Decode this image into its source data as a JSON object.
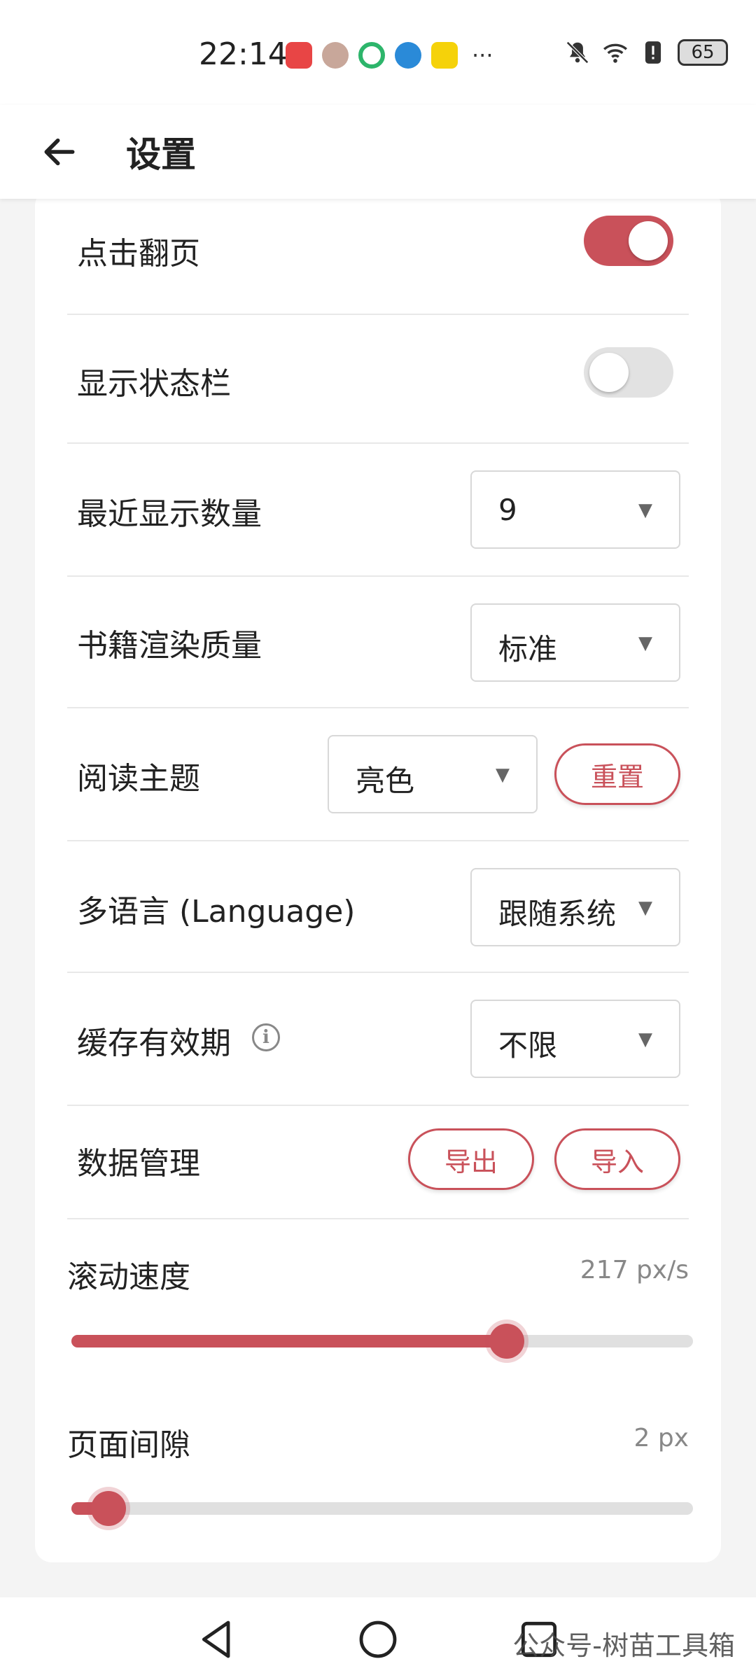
{
  "status_bar": {
    "time": "22:14",
    "battery": "65",
    "app_icons": [
      "huawei-store-icon",
      "avatar-app-icon",
      "green-app-icon",
      "blue-app-icon",
      "yellow-app-icon"
    ],
    "more": "···"
  },
  "app_bar": {
    "title": "设置"
  },
  "settings": {
    "page_turn": {
      "label": "点击翻页",
      "enabled": true
    },
    "show_status_bar": {
      "label": "显示状态栏",
      "enabled": false
    },
    "recent_count": {
      "label": "最近显示数量",
      "value": "9"
    },
    "render_quality": {
      "label": "书籍渲染质量",
      "value": "标准"
    },
    "reading_theme": {
      "label": "阅读主题",
      "value": "亮色",
      "reset_label": "重置"
    },
    "language": {
      "label": "多语言 (Language)",
      "value": "跟随系统"
    },
    "cache_ttl": {
      "label": "缓存有效期",
      "value": "不限",
      "info_glyph": "i"
    },
    "data_management": {
      "label": "数据管理",
      "export_label": "导出",
      "import_label": "导入"
    }
  },
  "sliders": {
    "scroll_speed": {
      "label": "滚动速度",
      "value_text": "217 px/s",
      "fraction": 0.7
    },
    "page_gap": {
      "label": "页面间隙",
      "value_text": "2 px",
      "fraction": 0.06
    }
  },
  "dropdown_arrow": "▼",
  "colors": {
    "accent": "#c9515a",
    "toggle_off": "#e2e2e2",
    "divider": "#e8e8e8",
    "background": "#f4f4f4"
  },
  "watermark": "公众号-树苗工具箱"
}
